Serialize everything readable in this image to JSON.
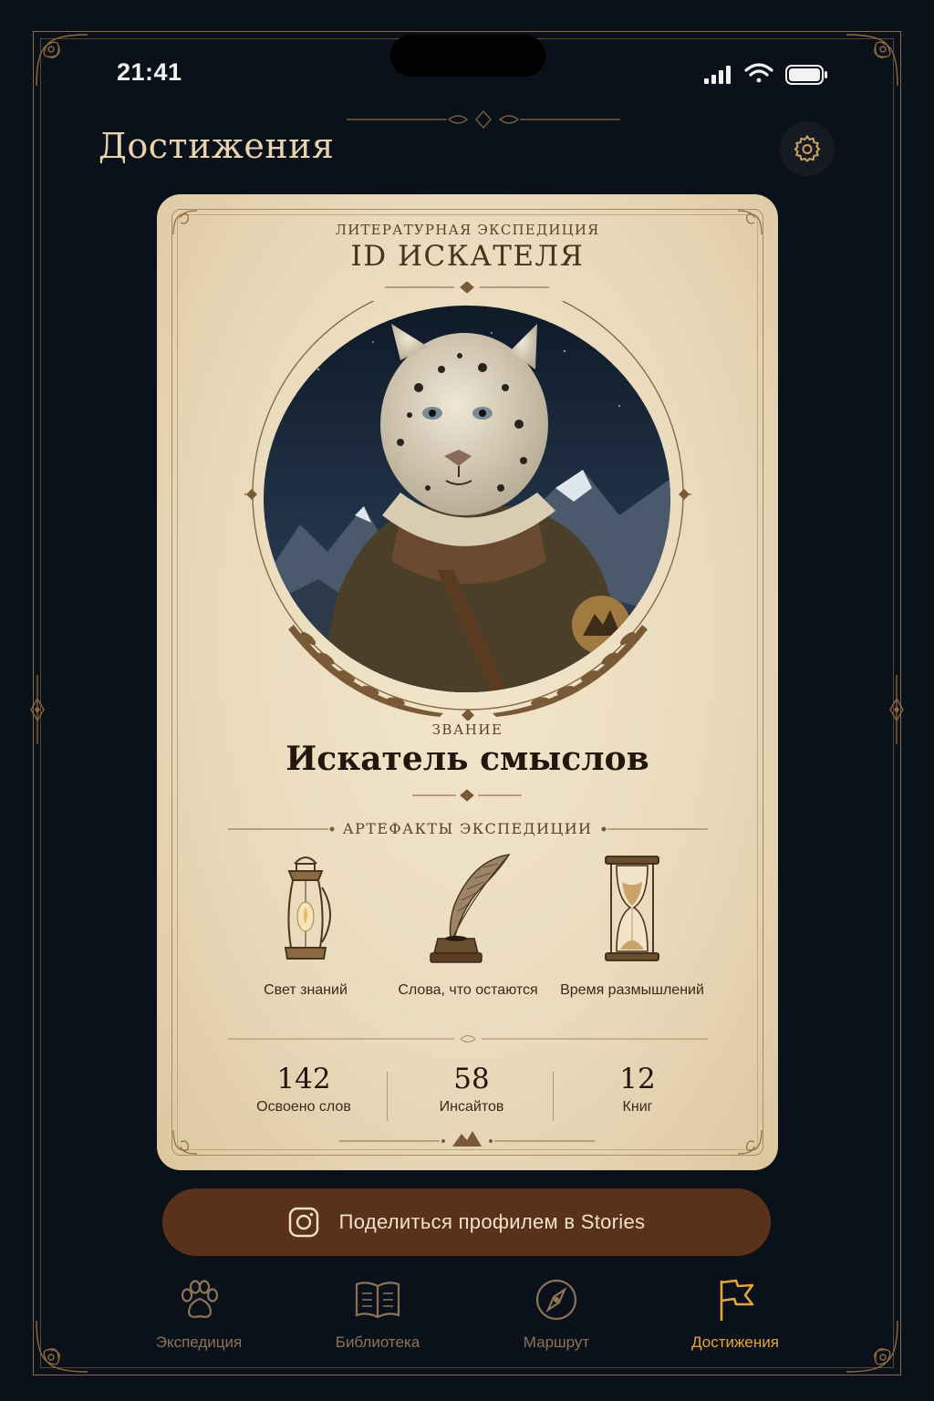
{
  "status_bar": {
    "time": "21:41"
  },
  "header": {
    "title": "Достижения",
    "settings_icon": "gear-icon"
  },
  "card": {
    "expedition_label": "ЛИТЕРАТУРНАЯ ЭКСПЕДИЦИЯ",
    "seeker_id": "ID ИСКАТЕЛЯ",
    "portrait": "snow-leopard-explorer-portrait",
    "rank_label": "ЗВАНИЕ",
    "rank_value": "Искатель смыслов",
    "artifacts_header": "АРТЕФАКТЫ ЭКСПЕДИЦИИ",
    "artifacts": [
      {
        "icon": "lantern-icon",
        "label": "Свет знаний"
      },
      {
        "icon": "quill-inkwell-icon",
        "label": "Слова, что остаются"
      },
      {
        "icon": "hourglass-icon",
        "label": "Время размышлений"
      }
    ],
    "stats": [
      {
        "value": "142",
        "label": "Освоено слов"
      },
      {
        "value": "58",
        "label": "Инсайтов"
      },
      {
        "value": "12",
        "label": "Книг"
      }
    ]
  },
  "share_button": {
    "label": "Поделиться профилем в Stories",
    "icon": "instagram-icon"
  },
  "tabbar": {
    "active_color": "#e8a33a",
    "items": [
      {
        "label": "Экспедиция",
        "icon": "paw-icon",
        "active": false
      },
      {
        "label": "Библиотека",
        "icon": "book-icon",
        "active": false
      },
      {
        "label": "Маршрут",
        "icon": "compass-icon",
        "active": false
      },
      {
        "label": "Достижения",
        "icon": "flag-icon",
        "active": true
      }
    ]
  }
}
